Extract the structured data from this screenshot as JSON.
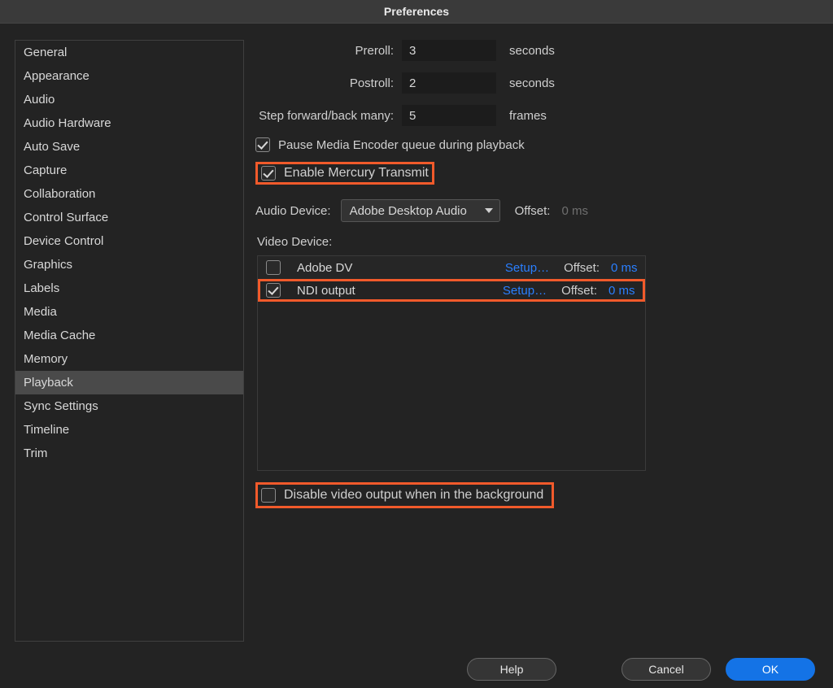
{
  "title": "Preferences",
  "sidebar": {
    "items": [
      {
        "label": "General"
      },
      {
        "label": "Appearance"
      },
      {
        "label": "Audio"
      },
      {
        "label": "Audio Hardware"
      },
      {
        "label": "Auto Save"
      },
      {
        "label": "Capture"
      },
      {
        "label": "Collaboration"
      },
      {
        "label": "Control Surface"
      },
      {
        "label": "Device Control"
      },
      {
        "label": "Graphics"
      },
      {
        "label": "Labels"
      },
      {
        "label": "Media"
      },
      {
        "label": "Media Cache"
      },
      {
        "label": "Memory"
      },
      {
        "label": "Playback",
        "selected": true
      },
      {
        "label": "Sync Settings"
      },
      {
        "label": "Timeline"
      },
      {
        "label": "Trim"
      }
    ]
  },
  "playback": {
    "preroll_label": "Preroll:",
    "preroll_value": "3",
    "postroll_label": "Postroll:",
    "postroll_value": "2",
    "seconds": "seconds",
    "step_label": "Step forward/back many:",
    "step_value": "5",
    "frames": "frames",
    "pause_me": {
      "checked": true,
      "label": "Pause Media Encoder queue during playback"
    },
    "mercury": {
      "checked": true,
      "label": "Enable Mercury Transmit"
    },
    "audio_device_label": "Audio Device:",
    "audio_device_value": "Adobe Desktop Audio",
    "audio_offset_label": "Offset:",
    "audio_offset_value": "0 ms",
    "video_device_label": "Video Device:",
    "video_devices": [
      {
        "checked": false,
        "name": "Adobe DV",
        "setup": "Setup…",
        "offset_label": "Offset:",
        "offset_value": "0 ms"
      },
      {
        "checked": true,
        "name": "NDI output",
        "setup": "Setup…",
        "offset_label": "Offset:",
        "offset_value": "0 ms"
      }
    ],
    "disable_bg": {
      "checked": false,
      "label": "Disable video output when in the background"
    }
  },
  "footer": {
    "help": "Help",
    "cancel": "Cancel",
    "ok": "OK"
  }
}
